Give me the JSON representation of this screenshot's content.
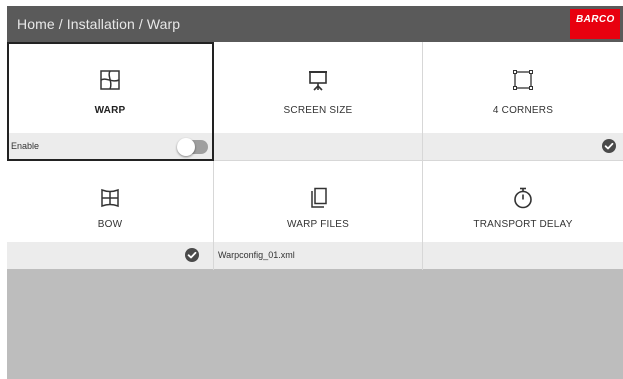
{
  "header": {
    "breadcrumb": "Home / Installation / Warp",
    "brand_logo": "BARCO"
  },
  "colors": {
    "header_bg": "#5a5a5a",
    "brand_red": "#e8000f",
    "tile_bg": "#ffffff",
    "footer_bg": "#ececec",
    "empty_area": "#bdbdbd",
    "selection_border": "#222222"
  },
  "tiles": [
    {
      "label": "WARP",
      "icon": "warp-icon",
      "selected": true,
      "footer": {
        "text": "Enable",
        "toggle": "off"
      }
    },
    {
      "label": "SCREEN SIZE",
      "icon": "screen-size-icon",
      "selected": false,
      "footer": {
        "text": ""
      }
    },
    {
      "label": "4 CORNERS",
      "icon": "four-corners-icon",
      "selected": false,
      "footer": {
        "text": "",
        "status": "check"
      }
    },
    {
      "label": "BOW",
      "icon": "bow-icon",
      "selected": false,
      "footer": {
        "text": "",
        "status": "check"
      }
    },
    {
      "label": "WARP FILES",
      "icon": "warp-files-icon",
      "selected": false,
      "footer": {
        "text": "Warpconfig_01.xml"
      }
    },
    {
      "label": "TRANSPORT DELAY",
      "icon": "stopwatch-icon",
      "selected": false,
      "footer": {
        "text": ""
      }
    }
  ]
}
